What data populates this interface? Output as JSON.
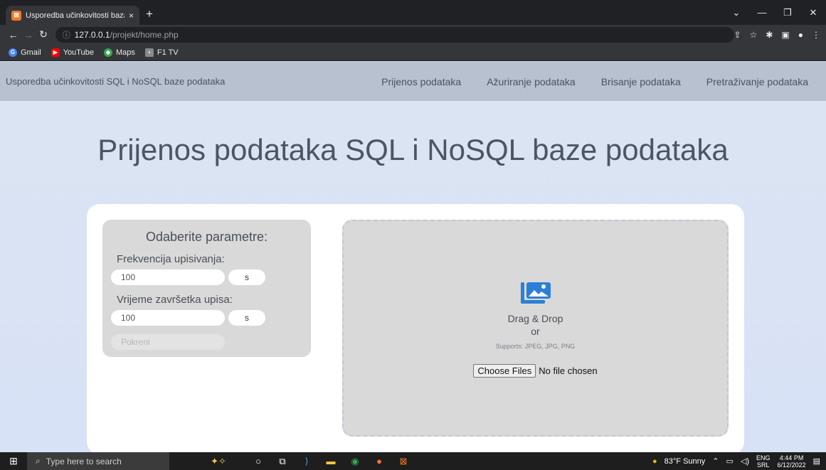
{
  "browser": {
    "tab_title": "Usporedba učinkovitosti baza",
    "tab_close": "×",
    "new_tab": "+",
    "url_host": "127.0.0.1",
    "url_path": "/projekt/home.php",
    "bookmarks": [
      "Gmail",
      "YouTube",
      "Maps",
      "F1 TV"
    ]
  },
  "site": {
    "brand": "Usporedba učinkovitosti SQL i NoSQL baze podataka",
    "nav": [
      "Prijenos podataka",
      "Ažuriranje podataka",
      "Brisanje podataka",
      "Pretraživanje podataka"
    ],
    "hero": "Prijenos podataka SQL i NoSQL baze podataka"
  },
  "params": {
    "heading": "Odaberite parametre:",
    "freq_label": "Frekvencija upisivanja:",
    "freq_value": "100",
    "freq_unit": "s",
    "end_label": "Vrijeme završetka upisa:",
    "end_value": "100",
    "end_unit": "s",
    "start_button": "Pokreni"
  },
  "upload": {
    "title": "Drag & Drop",
    "or": "or",
    "supports": "Supports: JPEG, JPG, PNG",
    "choose_button": "Choose Files",
    "no_file": "No file chosen"
  },
  "taskbar": {
    "search_placeholder": "Type here to search",
    "weather": "83°F  Sunny",
    "lang_top": "ENG",
    "lang_bottom": "SRL",
    "time": "4:44 PM",
    "date": "6/12/2022"
  },
  "colors": {
    "accent_icon": "#2b7fd6",
    "nav_bg": "#b7c1d0"
  }
}
